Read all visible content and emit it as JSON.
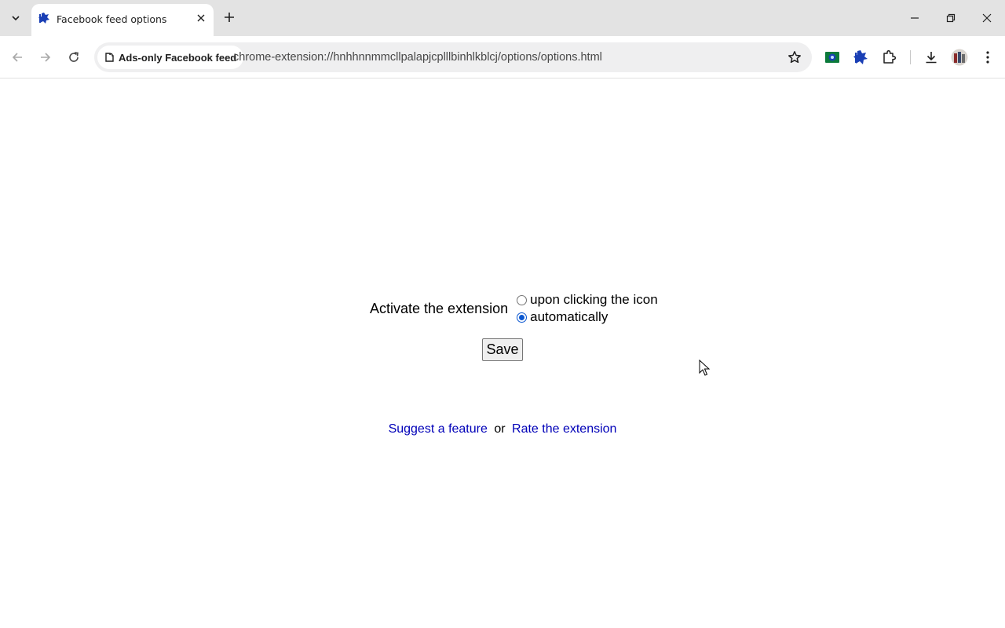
{
  "tab": {
    "title": "Facebook feed options"
  },
  "omnibox": {
    "site_chip": "Ads-only Facebook feed",
    "url": "chrome-extension://hnhhnnmmcllpalapjcplllbinhlkblcj/options/options.html"
  },
  "options": {
    "activate_label": "Activate the extension",
    "radio_options": [
      {
        "label": "upon clicking the icon",
        "checked": false
      },
      {
        "label": "automatically",
        "checked": true
      }
    ],
    "save_label": "Save"
  },
  "footer": {
    "suggest_link": "Suggest a feature",
    "or_text": "or",
    "rate_link": "Rate the extension"
  },
  "colors": {
    "accent": "#0b57d0",
    "link": "#0000b8",
    "tabstrip_bg": "#e3e3e3",
    "omnibox_bg": "#efeff0"
  },
  "icons": [
    "tab-search-icon",
    "extension-favicon-icon",
    "close-icon",
    "plus-icon",
    "minimize-icon",
    "restore-icon",
    "window-close-icon",
    "back-icon",
    "forward-icon",
    "reload-icon",
    "extension-chip-icon",
    "star-icon",
    "camera-extension-icon",
    "blue-splash-extension-icon",
    "puzzle-extensions-icon",
    "download-icon",
    "profile-avatar-icon",
    "more-menu-icon",
    "mouse-cursor-icon"
  ]
}
